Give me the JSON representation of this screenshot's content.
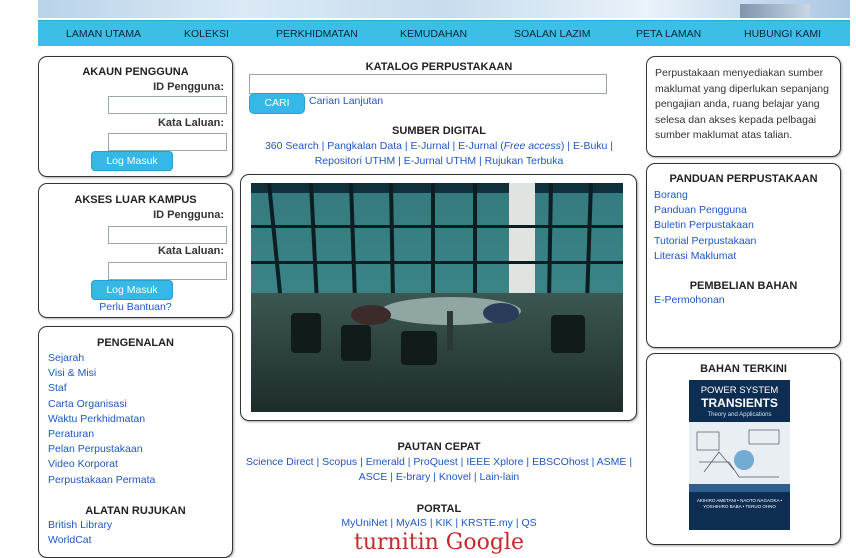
{
  "nav": [
    "LAMAN UTAMA",
    "KOLEKSI",
    "PERKHIDMATAN",
    "KEMUDAHAN",
    "SOALAN LAZIM",
    "PETA LAMAN",
    "HUBUNGI KAMI"
  ],
  "akaun": {
    "title": "AKAUN PENGGUNA",
    "id_label": "ID Pengguna:",
    "pw_label": "Kata Laluan:",
    "button": "Log Masuk"
  },
  "akses": {
    "title": "AKSES LUAR KAMPUS",
    "id_label": "ID Pengguna:",
    "pw_label": "Kata Laluan:",
    "button": "Log Masuk",
    "help": "Perlu Bantuan?"
  },
  "pengenalan": {
    "title": "PENGENALAN",
    "items": [
      "Sejarah",
      "Visi & Misi",
      "Staf",
      "Carta Organisasi",
      "Waktu Perkhidmatan",
      "Peraturan",
      "Pelan Perpustakaan",
      "Video Korporat",
      "Perpustakaan Permata"
    ]
  },
  "alatan": {
    "title": "ALATAN RUJUKAN",
    "items": [
      "British Library",
      "WorldCat"
    ]
  },
  "katalog": {
    "title": "KATALOG PERPUSTAKAAN",
    "button": "CARI",
    "advanced": "Carian Lanjutan"
  },
  "sumber": {
    "title": "SUMBER DIGITAL",
    "line1_a": "360 Search | Pangkalan Data | E-Jurnal | E-Jurnal (",
    "line1_em": "Free access",
    "line1_b": ") | E-Buku |",
    "line2": "Repositori UTHM | E-Jurnal UTHM | Rujukan Terbuka"
  },
  "pautan": {
    "title": "PAUTAN CEPAT",
    "line1": "Science Direct | Scopus | Emerald | ProQuest | IEEE Xplore | EBSCOhost | ASME |",
    "line2": "ASCE | E-brary | Knovel | Lain-lain"
  },
  "portal": {
    "title": "PORTAL",
    "line1": "MyUniNet | MyAIS | KIK | KRSTE.my | QS",
    "logos": "turnitin  Google"
  },
  "intro": {
    "text": "Perpustakaan menyediakan sumber maklumat yang diperlukan sepanjang pengajian anda, ruang belajar yang selesa dan akses kepada pelbagai sumber maklumat atas talian."
  },
  "panduan": {
    "title": "PANDUAN PERPUSTAKAAN",
    "items": [
      "Borang",
      "Panduan Pengguna",
      "Buletin Perpustakaan",
      "Tutorial Perpustakaan",
      "Literasi Maklumat"
    ]
  },
  "pembelian": {
    "title": "PEMBELIAN BAHAN",
    "items": [
      "E-Permohonan"
    ]
  },
  "bahan": {
    "title": "BAHAN TERKINI",
    "book_title1": "POWER SYSTEM",
    "book_title2": "TRANSIENTS",
    "book_sub": "Theory and Applications",
    "book_authors": "AKIHIRO AMETANI • NAOTO NAGAOKA • YOSHIHIRO BABA • TERUO OHNO"
  },
  "colors": {
    "nav": "#3bbfe6",
    "link": "#1f57c4",
    "button": "#35b8e8"
  }
}
